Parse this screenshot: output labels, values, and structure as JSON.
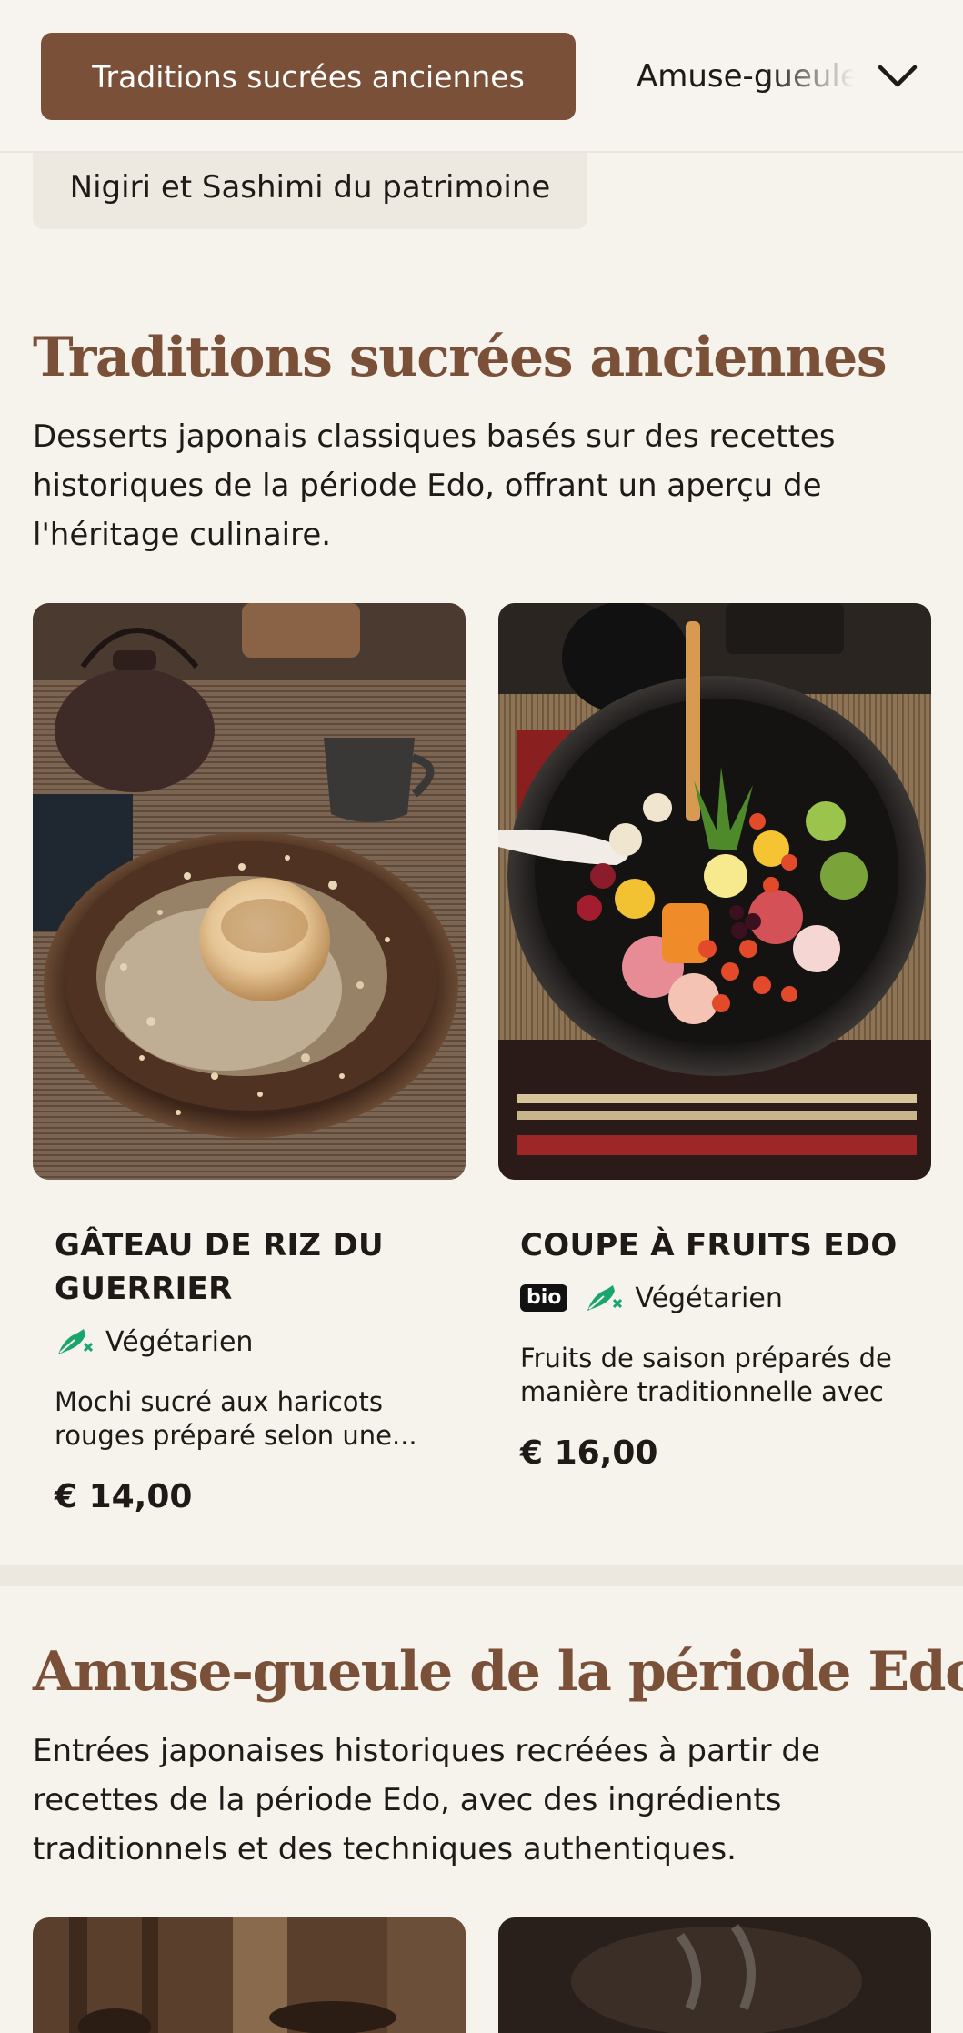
{
  "nav": {
    "active_category": "Traditions sucrées anciennes",
    "next_category": "Amuse-gueule",
    "second_category": "Nigiri et Sashimi du patrimoine",
    "expand_icon": "chevron-down-icon"
  },
  "sections": [
    {
      "title": "Traditions sucrées anciennes",
      "description": "Desserts japonais classiques basés sur des recettes historiques de la période Edo, offrant un aperçu de l'héritage culinaire.",
      "items": [
        {
          "name": "GÂTEAU DE RIZ DU GUERRIER",
          "tags": [
            "Végétarien"
          ],
          "description": "Mochi sucré aux haricots rouges préparé selon une...",
          "price": "€ 14,00"
        },
        {
          "name": "COUPE À FRUITS EDO",
          "badge": "bio",
          "tags": [
            "Végétarien"
          ],
          "description": "Fruits de saison préparés de manière traditionnelle avec ...",
          "price": "€ 16,00"
        }
      ]
    },
    {
      "title": "Amuse-gueule de la période Edo",
      "description": "Entrées japonaises historiques recréées à partir de recettes de la période Edo, avec des ingrédients traditionnels et des techniques authentiques."
    }
  ],
  "colors": {
    "accent": "#7a5038",
    "background": "#f6f2ec",
    "veg_green": "#1aa56b"
  }
}
